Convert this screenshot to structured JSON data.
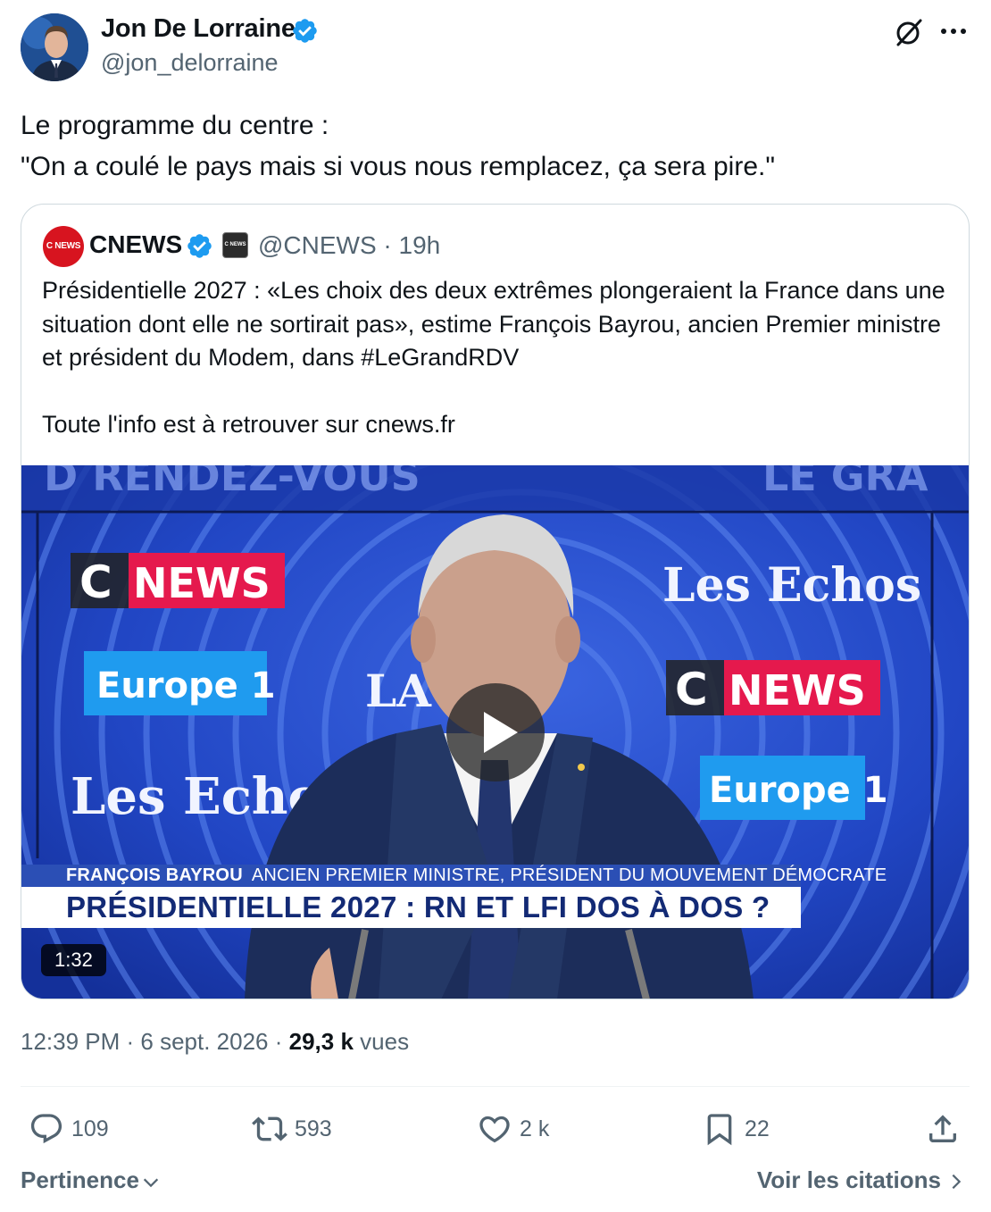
{
  "tweet": {
    "author": {
      "name": "Jon De Lorraine",
      "handle": "@jon_delorraine"
    },
    "text": "Le programme du centre :\n\"On a coulé le pays mais si vous nous remplacez, ça sera pire.\"",
    "meta": {
      "time": "12:39 PM · 6 sept. 2026 · ",
      "views_count": "29,3 k",
      "views_label": " vues"
    },
    "actions": {
      "replies": "109",
      "reposts": "593",
      "likes": "2 k",
      "bookmarks": "22"
    }
  },
  "quoted_tweet": {
    "avatar_text": "C NEWS",
    "affiliate_badge_text": "C NEWS",
    "name": "CNEWS",
    "handle_time": "@CNEWS · 19h",
    "text_p1": "Présidentielle 2027 : «Les choix des deux extrêmes plongeraient la France dans une situation dont elle ne sortirait pas», estime François Bayrou, ancien Premier ministre et président du Modem, dans #LeGrandRDV",
    "text_p2": "Toute l'info est à retrouver sur cnews.fr",
    "video": {
      "duration": "1:32",
      "banner_top": "D RENDEZ-VOUS",
      "banner_top_right": "LE GRA",
      "logos": {
        "cnews_c": "C",
        "cnews_word": "NEWS",
        "europe1": "Europe 1",
        "lesechos": "Les Echos",
        "la": "LA"
      },
      "lower_third_name": "FRANÇOIS BAYROU",
      "lower_third_role": "ANCIEN PREMIER MINISTRE, PRÉSIDENT DU MOUVEMENT DÉMOCRATE",
      "headline": "PRÉSIDENTIELLE 2027 : RN ET LFI DOS À DOS ?"
    }
  },
  "footer": {
    "sort_label": "Pertinence",
    "quotes_link": "Voir les citations"
  },
  "colors": {
    "verified": "#1d9bf0",
    "secondary_text": "#536471",
    "border": "#cfd9de",
    "cnews_red": "#d7141f",
    "studio_blue": "#1e3fb8"
  },
  "icons": [
    "verified-badge-icon",
    "grok-icon",
    "more-icon",
    "play-icon",
    "reply-icon",
    "repost-icon",
    "like-icon",
    "bookmark-icon",
    "share-icon",
    "chevron-down-icon",
    "chevron-right-icon"
  ]
}
